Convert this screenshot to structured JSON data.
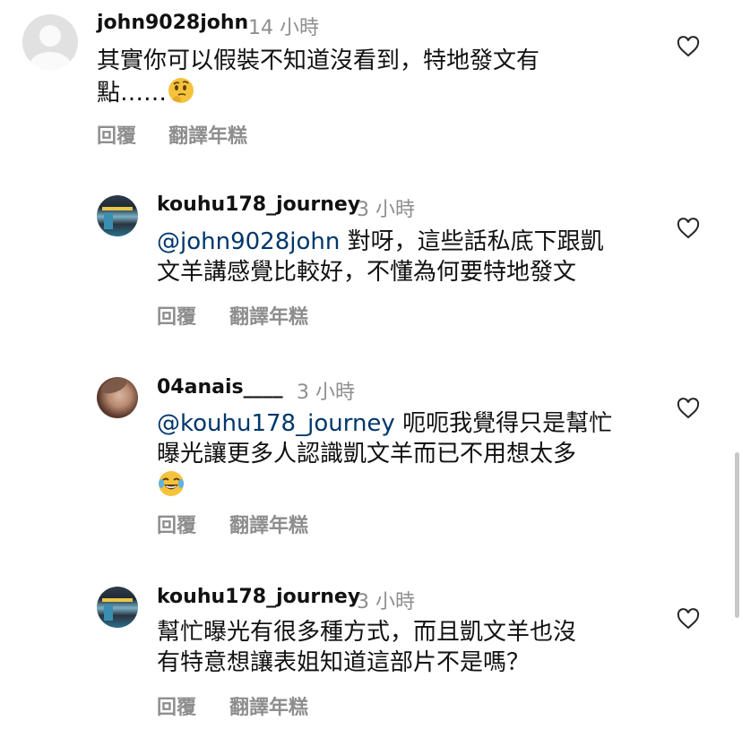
{
  "comments": [
    {
      "username": "john9028john",
      "time": "14 小時",
      "lines": [
        "其實你可以假裝不知道沒看到，特地發文有",
        "點……"
      ],
      "emoji": "thinking-face-emoji",
      "reply": "回覆",
      "translate": "翻譯年糕"
    },
    {
      "username": "kouhu178_journey",
      "time": "3 小時",
      "mention": "@john9028john",
      "lines": [
        " 對呀，這些話私底下跟凱",
        "文羊講感覺比較好，不懂為何要特地發文"
      ],
      "reply": "回覆",
      "translate": "翻譯年糕"
    },
    {
      "username": "04anais____",
      "time": "3 小時",
      "mention": "@kouhu178_journey",
      "lines": [
        " 呃呃我覺得只是幫忙",
        "曝光讓更多人認識凱文羊而已不用想太多"
      ],
      "emoji": "tears-of-joy-emoji",
      "reply": "回覆",
      "translate": "翻譯年糕"
    },
    {
      "username": "kouhu178_journey",
      "time": "3 小時",
      "lines": [
        "幫忙曝光有很多種方式，而且凱文羊也沒",
        "有特意想讓表姐知道這部片不是嗎？"
      ],
      "reply": "回覆",
      "translate": "翻譯年糕"
    }
  ],
  "colors": {
    "username": "#111111",
    "meta": "#8e8e8e",
    "mention": "#00376b",
    "heart": "#262626"
  },
  "icons": [
    "heart-icon",
    "avatar-default-icon"
  ]
}
